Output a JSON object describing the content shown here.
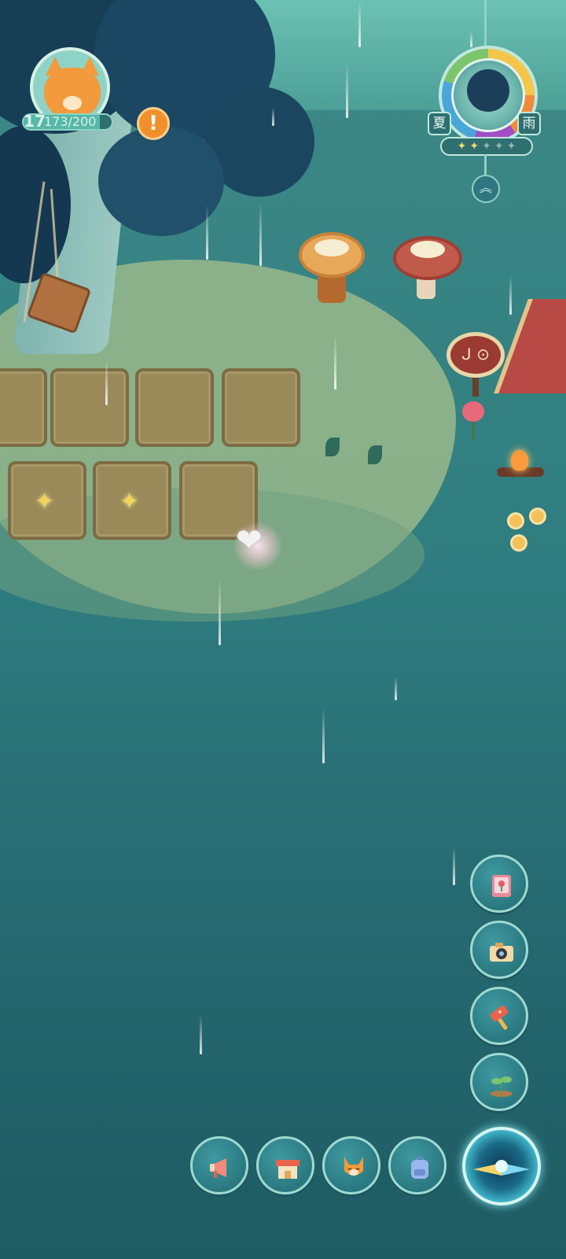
{
  "player": {
    "level": "17",
    "xp_text": "173/200",
    "xp_current": 173,
    "xp_max": 200,
    "avatar": "fox-avatar"
  },
  "notice": {
    "icon": "exclamation-icon",
    "symbol": "!"
  },
  "weather": {
    "season": "夏",
    "condition": "雨",
    "stars_filled": 2,
    "stars_total": 5
  },
  "expand_symbol": "︽",
  "sign_text": "ᒍ ⊙",
  "side_buttons": [
    {
      "name": "flower-book-button",
      "icon": "flower-book-icon"
    },
    {
      "name": "camera-button",
      "icon": "camera-icon"
    },
    {
      "name": "hammer-button",
      "icon": "hammer-icon"
    },
    {
      "name": "sprout-button",
      "icon": "sprout-icon"
    }
  ],
  "bottom_buttons": [
    {
      "name": "megaphone-button",
      "icon": "megaphone-icon"
    },
    {
      "name": "shop-button",
      "icon": "shop-icon"
    },
    {
      "name": "fox-character-button",
      "icon": "fox-icon"
    },
    {
      "name": "backpack-button",
      "icon": "backpack-icon"
    }
  ],
  "compass": {
    "icon": "compass-icon"
  },
  "colors": {
    "water": "#2f7d80",
    "accent": "#9fdad0",
    "alert": "#f0902c",
    "star_on": "#f5de6a"
  }
}
